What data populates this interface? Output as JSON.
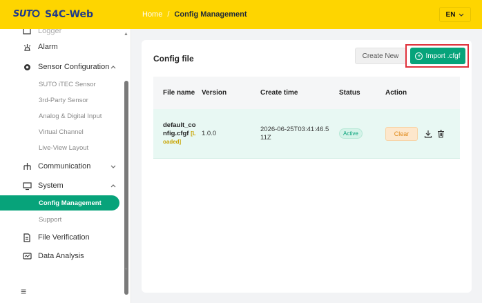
{
  "app": {
    "logo_text": "SUTO",
    "name": "S4C-Web"
  },
  "breadcrumb": {
    "home": "Home",
    "separator": "/",
    "current": "Config Management"
  },
  "language": {
    "selected": "EN"
  },
  "sidebar": {
    "partial_top_label": "Logger",
    "items": [
      {
        "label": "Alarm",
        "icon": "alarm-icon"
      },
      {
        "label": "Sensor Configuration",
        "icon": "gear-icon",
        "expanded": true
      },
      {
        "label": "Communication",
        "icon": "network-icon",
        "expanded": false
      },
      {
        "label": "System",
        "icon": "monitor-icon",
        "expanded": true
      },
      {
        "label": "File Verification",
        "icon": "file-icon"
      },
      {
        "label": "Data Analysis",
        "icon": "chart-monitor-icon"
      }
    ],
    "sensor_sub": [
      "SUTO iTEC Sensor",
      "3rd-Party Sensor",
      "Analog & Digital Input",
      "Virtual Channel",
      "Live-View Layout"
    ],
    "system_sub": [
      "Config Management",
      "Support"
    ]
  },
  "card": {
    "title": "Config file",
    "create_label": "Create New",
    "import_label": "Import .cfgf"
  },
  "table": {
    "headers": [
      "File name",
      "Version",
      "Create time",
      "Status",
      "Action"
    ],
    "rows": [
      {
        "file_name": "default_config.cfgf",
        "loaded_tag": "[Loaded]",
        "version": "1.0.0",
        "create_time": "2026-06-25T03:41:46.511Z",
        "status": "Active",
        "clear_label": "Clear"
      }
    ]
  },
  "colors": {
    "header_bg": "#fed500",
    "brand_blue": "#1f3a8a",
    "accent_green": "#07a37a",
    "highlight_red": "#e0303a"
  }
}
